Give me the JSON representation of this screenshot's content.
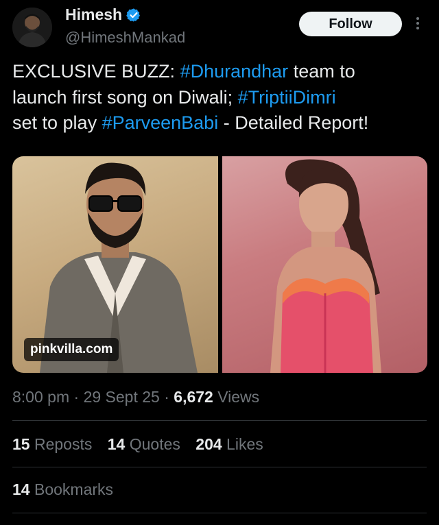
{
  "author": {
    "display_name": "Himesh",
    "handle": "@HimeshMankad",
    "verified": true,
    "verified_color": "#1d9bf0"
  },
  "follow_button": {
    "label": "Follow"
  },
  "tweet": {
    "lines": [
      [
        {
          "text": "EXCLUSIVE BUZZ: ",
          "tag": false
        },
        {
          "text": "#Dhurandhar",
          "tag": true
        },
        {
          "text": " team to",
          "tag": false
        }
      ],
      [
        {
          "text": "launch first song on Diwali; ",
          "tag": false
        },
        {
          "text": "#TriptiiDimri",
          "tag": true
        }
      ],
      [
        {
          "text": "set to play ",
          "tag": false
        },
        {
          "text": "#ParveenBabi",
          "tag": true
        },
        {
          "text": " - Detailed Report!",
          "tag": false
        }
      ]
    ]
  },
  "media": {
    "source_badge": "pinkvilla.com"
  },
  "meta": {
    "time": "8:00 pm",
    "separator": " · ",
    "date": "29 Sept 25",
    "views_count": "6,672",
    "views_label": " Views"
  },
  "stats": {
    "reposts": {
      "count": "15",
      "label": " Reposts"
    },
    "quotes": {
      "count": "14",
      "label": " Quotes"
    },
    "likes": {
      "count": "204",
      "label": " Likes"
    },
    "bookmarks": {
      "count": "14",
      "label": " Bookmarks"
    }
  },
  "colors": {
    "background": "#000000",
    "text": "#e7e9ea",
    "muted": "#71767b",
    "link": "#1d9bf0",
    "divider": "#2f3336"
  },
  "icons": [
    "verified-badge-icon",
    "more-options-icon"
  ]
}
